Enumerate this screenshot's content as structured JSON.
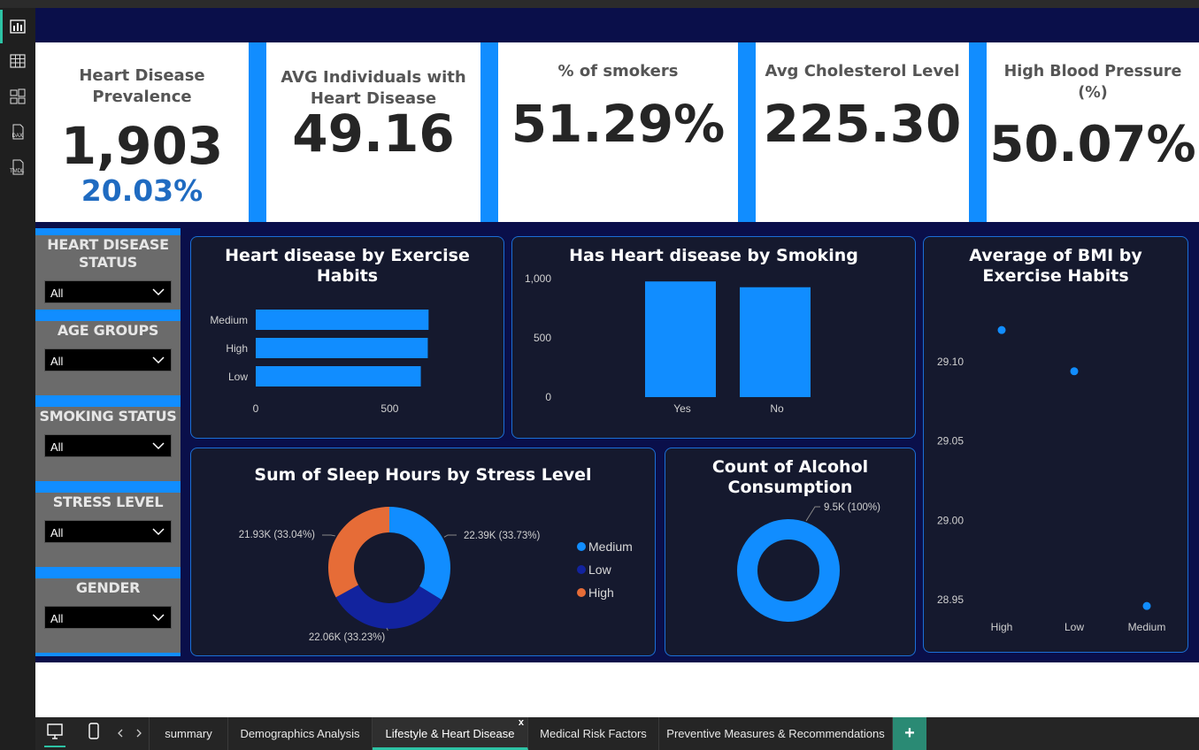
{
  "kpis": {
    "prevalence": {
      "title": "Heart Disease Prevalence",
      "value": "1,903",
      "sub": "20.03%"
    },
    "avg_individuals": {
      "title_line1": "AVG Individuals with",
      "title_line2": "Heart Disease",
      "value": "49.16"
    },
    "smokers": {
      "title": "% of smokers",
      "value": "51.29%"
    },
    "cholesterol": {
      "title": "Avg Cholesterol Level",
      "value": "225.30"
    },
    "blood_pressure": {
      "title": "High Blood Pressure (%)",
      "value": "50.07%"
    }
  },
  "slicers": [
    {
      "title_line1": "HEART DISEASE",
      "title_line2": "STATUS",
      "value": "All"
    },
    {
      "title_line1": "AGE GROUPS",
      "title_line2": "",
      "value": "All"
    },
    {
      "title_line1": "SMOKING STATUS",
      "title_line2": "",
      "value": "All"
    },
    {
      "title_line1": "STRESS LEVEL",
      "title_line2": "",
      "value": "All"
    },
    {
      "title_line1": "GENDER",
      "title_line2": "",
      "value": "All"
    }
  ],
  "tabs": [
    "summary",
    "Demographics Analysis",
    "Lifestyle & Heart Disease",
    "Medical Risk Factors",
    "Preventive Measures & Recommendations"
  ],
  "active_tab": "Lifestyle & Heart Disease",
  "tab_close": "x",
  "add_tab": "+",
  "colors": {
    "accent": "#118dff",
    "navy": "#0a0f4a",
    "panel": "#15192e",
    "dark_blue": "#12239e",
    "orange": "#e66c37",
    "teal": "#2dc3a5"
  },
  "chart_data": [
    {
      "type": "bar",
      "orientation": "horizontal",
      "title_line1": "Heart disease by Exercise",
      "title_line2": "Habits",
      "categories": [
        "Medium",
        "High",
        "Low"
      ],
      "values": [
        645,
        642,
        616
      ],
      "xticks": [
        "0",
        "500"
      ],
      "xlim": [
        0,
        700
      ]
    },
    {
      "type": "bar",
      "title": "Has Heart disease by Smoking",
      "categories": [
        "Yes",
        "No"
      ],
      "values": [
        976,
        927
      ],
      "yticks": [
        "0",
        "500",
        "1,000"
      ],
      "ylim": [
        0,
        1000
      ]
    },
    {
      "type": "pie",
      "title": "Sum of Sleep Hours by Stress Level",
      "slices": [
        {
          "label": "Medium",
          "value": 22390,
          "text": "22.39K (33.73%)",
          "color": "#118dff"
        },
        {
          "label": "Low",
          "value": 22060,
          "text": "22.06K (33.23%)",
          "color": "#12239e"
        },
        {
          "label": "High",
          "value": 21930,
          "text": "21.93K (33.04%)",
          "color": "#e66c37"
        }
      ],
      "legend": [
        "Medium",
        "Low",
        "High"
      ]
    },
    {
      "type": "pie",
      "title_line1": "Count of Alcohol",
      "title_line2": "Consumption",
      "slices": [
        {
          "label": "",
          "value": 9500,
          "text": "9.5K (100%)",
          "color": "#118dff"
        }
      ]
    },
    {
      "type": "scatter",
      "title_line1": "Average of BMI by",
      "title_line2": "Exercise Habits",
      "categories": [
        "High",
        "Low",
        "Medium"
      ],
      "values": [
        29.12,
        29.094,
        28.946
      ],
      "yticks": [
        "28.95",
        "29.00",
        "29.05",
        "29.10"
      ],
      "ylim": [
        28.94,
        29.14
      ]
    }
  ]
}
